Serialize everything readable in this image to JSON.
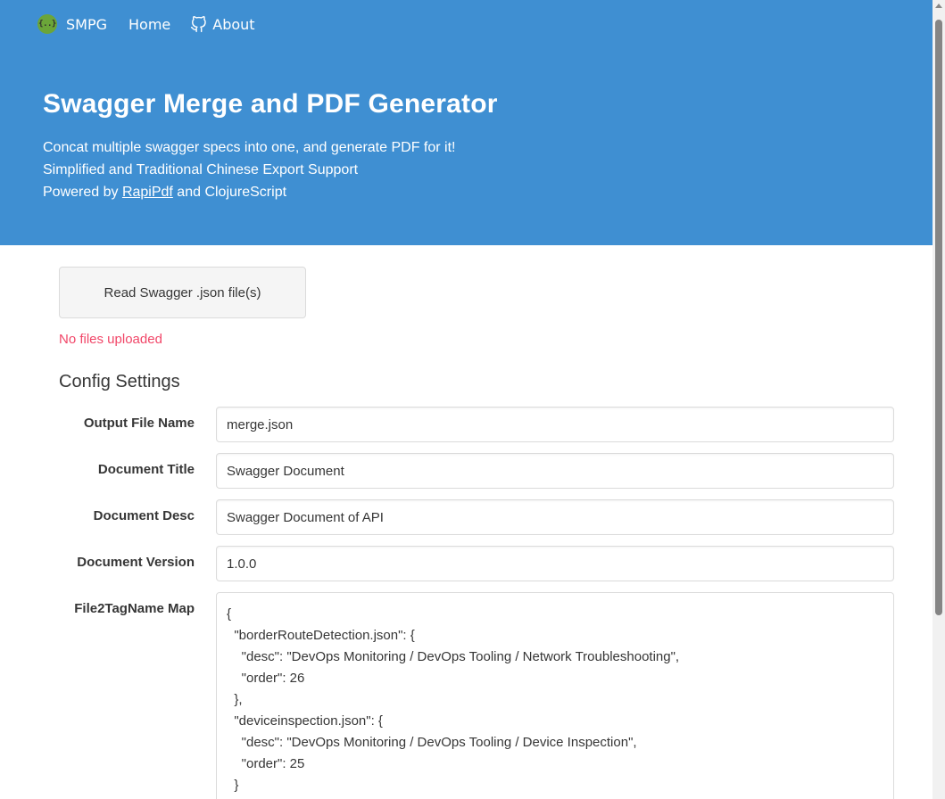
{
  "nav": {
    "brand": "SMPG",
    "logo_glyph": "{..}",
    "home": "Home",
    "about": "About",
    "about_icon": "github-icon"
  },
  "hero": {
    "title": "Swagger Merge and PDF Generator",
    "line1": "Concat multiple swagger specs into one, and generate PDF for it!",
    "line2": "Simplified and Traditional Chinese Export Support",
    "line3_prefix": "Powered by ",
    "line3_link": "RapiPdf",
    "line3_suffix": " and ClojureScript",
    "background_color": "#3f8fd2"
  },
  "upload": {
    "button_label": "Read Swagger .json file(s)",
    "status": "No files uploaded",
    "status_color": "#f14668"
  },
  "config": {
    "heading": "Config Settings",
    "fields": [
      {
        "label": "Output File Name",
        "value": "merge.json"
      },
      {
        "label": "Document Title",
        "value": "Swagger Document"
      },
      {
        "label": "Document Desc",
        "value": "Swagger Document of API"
      },
      {
        "label": "Document Version",
        "value": "1.0.0"
      }
    ],
    "map_label": "File2TagName Map",
    "map_value": "{\n  \"borderRouteDetection.json\": {\n    \"desc\": \"DevOps Monitoring / DevOps Tooling / Network Troubleshooting\",\n    \"order\": 26\n  },\n  \"deviceinspection.json\": {\n    \"desc\": \"DevOps Monitoring / DevOps Tooling / Device Inspection\",\n    \"order\": 25\n  }"
  }
}
